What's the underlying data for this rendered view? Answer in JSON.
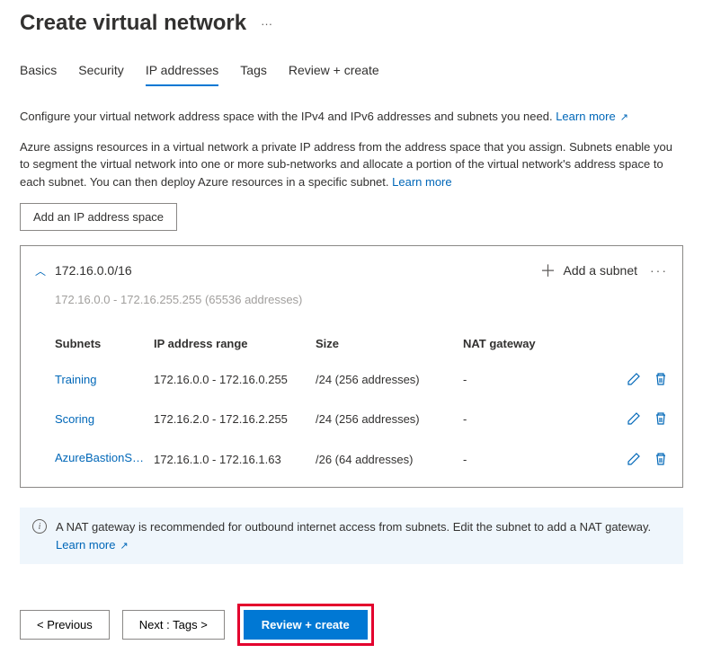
{
  "page_title": "Create virtual network",
  "tabs": {
    "basics": "Basics",
    "security": "Security",
    "ip_addresses": "IP addresses",
    "tags": "Tags",
    "review_create": "Review + create"
  },
  "desc1_text": "Configure your virtual network address space with the IPv4 and IPv6 addresses and subnets you need.",
  "desc1_link": "Learn more",
  "desc2_text": "Azure assigns resources in a virtual network a private IP address from the address space that you assign. Subnets enable you to segment the virtual network into one or more sub-networks and allocate a portion of the virtual network's address space to each subnet. You can then deploy Azure resources in a specific subnet.",
  "desc2_link": "Learn more",
  "add_addr_space_btn": "Add an IP address space",
  "addr_space": {
    "cidr": "172.16.0.0/16",
    "range_text": "172.16.0.0 - 172.16.255.255 (65536 addresses)",
    "add_subnet_label": "Add a subnet"
  },
  "columns": {
    "subnets": "Subnets",
    "range": "IP address range",
    "size": "Size",
    "nat": "NAT gateway"
  },
  "subnets": [
    {
      "name": "Training",
      "range": "172.16.0.0 - 172.16.0.255",
      "size": "/24 (256 addresses)",
      "nat": "-"
    },
    {
      "name": "Scoring",
      "range": "172.16.2.0 - 172.16.2.255",
      "size": "/24 (256 addresses)",
      "nat": "-"
    },
    {
      "name": "AzureBastionSubnet",
      "range": "172.16.1.0 - 172.16.1.63",
      "size": "/26 (64 addresses)",
      "nat": "-"
    }
  ],
  "info_banner": {
    "text": "A NAT gateway is recommended for outbound internet access from subnets. Edit the subnet to add a NAT gateway.",
    "link": "Learn more"
  },
  "footer": {
    "previous": "< Previous",
    "next": "Next : Tags >",
    "review": "Review + create"
  }
}
